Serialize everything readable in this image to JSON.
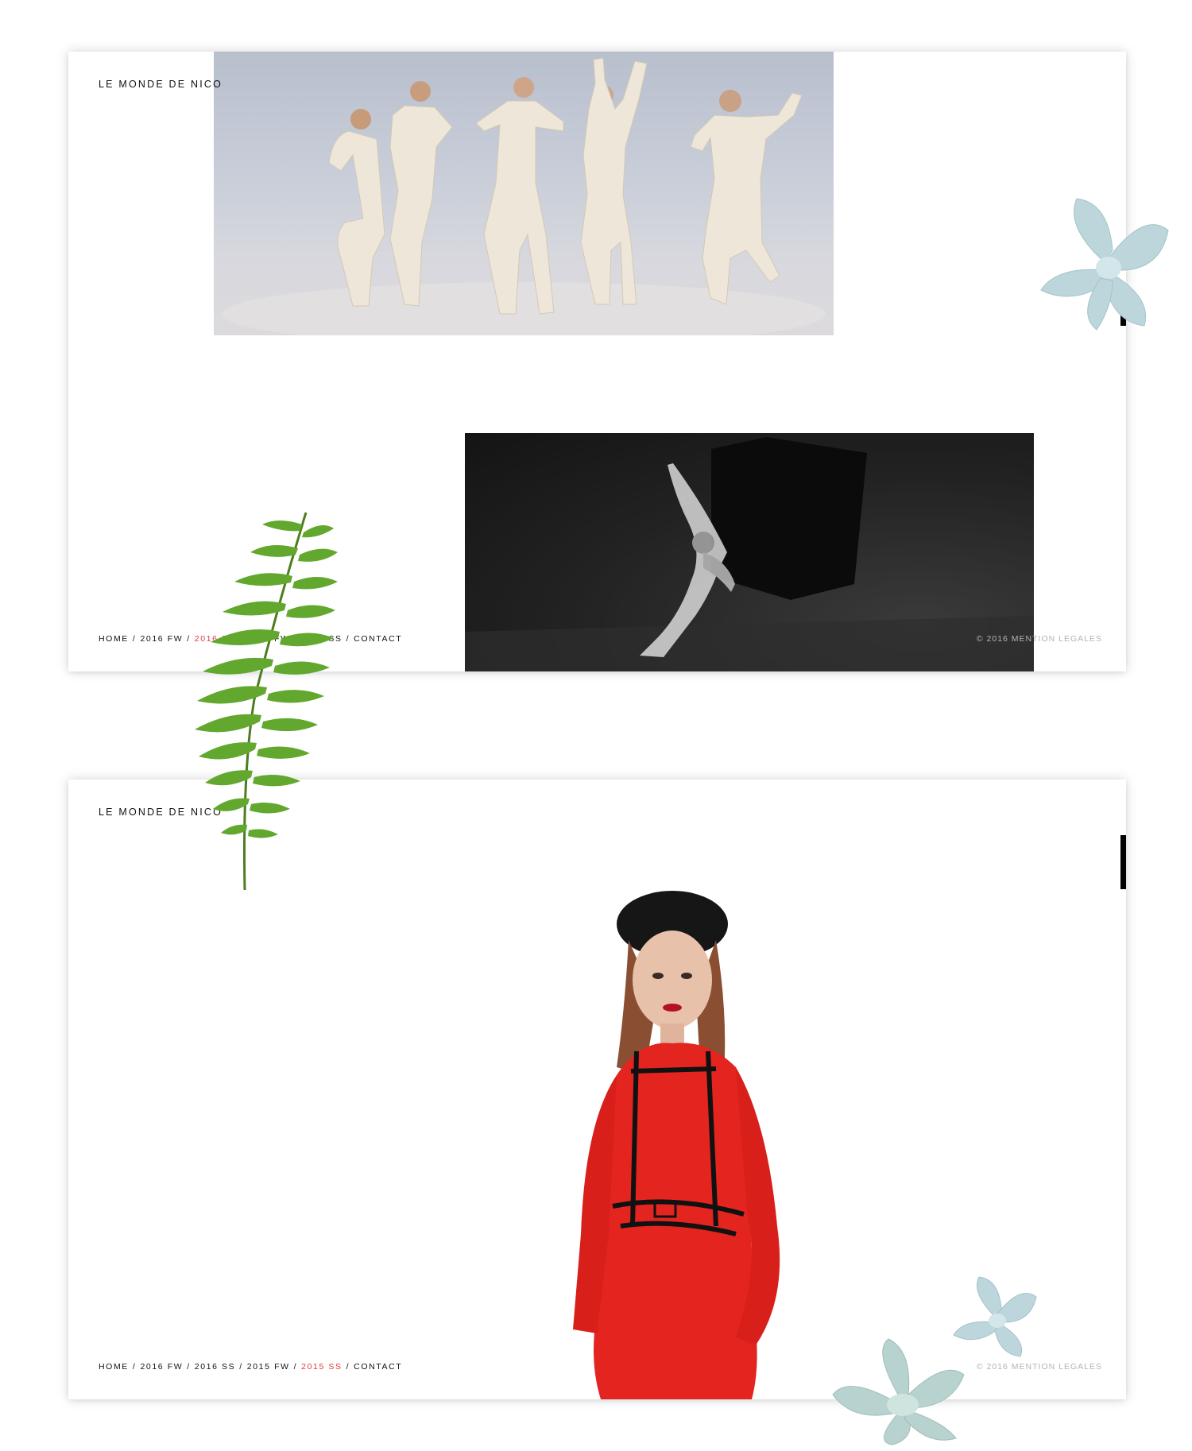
{
  "screens": [
    {
      "logo": "LE MONDE DE NICO",
      "nav": [
        {
          "label": "HOME",
          "active": false
        },
        {
          "label": "2016 FW",
          "active": false
        },
        {
          "label": "2016 SS",
          "active": true
        },
        {
          "label": "2015 FW",
          "active": false
        },
        {
          "label": "2015 SS",
          "active": false
        },
        {
          "label": "CONTACT",
          "active": false
        }
      ],
      "legal": "© 2016 MENTION LEGALES"
    },
    {
      "logo": "LE MONDE DE NICO",
      "nav": [
        {
          "label": "HOME",
          "active": false
        },
        {
          "label": "2016 FW",
          "active": false
        },
        {
          "label": "2016 SS",
          "active": false
        },
        {
          "label": "2015 FW",
          "active": false
        },
        {
          "label": "2015 SS",
          "active": true
        },
        {
          "label": "CONTACT",
          "active": false
        }
      ],
      "legal": "© 2016 MENTION LEGALES"
    }
  ],
  "colors": {
    "active_link": "#e0393e",
    "text": "#111111",
    "legal_text": "#b3b3b3",
    "fern": "#5fa02b",
    "flower": "#b9d3d9"
  }
}
